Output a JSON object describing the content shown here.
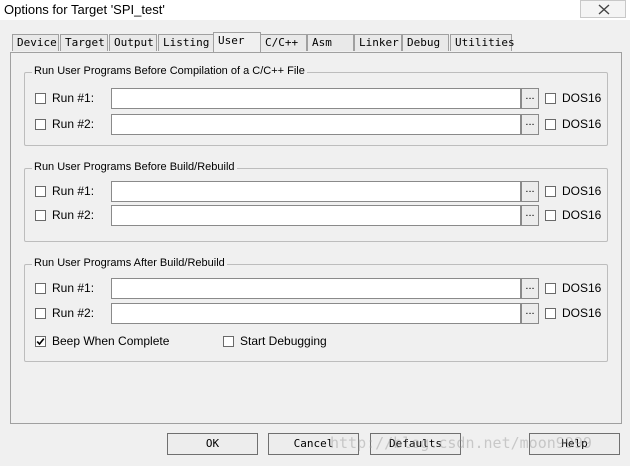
{
  "window": {
    "title": "Options for Target 'SPI_test'"
  },
  "tabs": [
    {
      "label": "Device"
    },
    {
      "label": "Target"
    },
    {
      "label": "Output"
    },
    {
      "label": "Listing"
    },
    {
      "label": "User"
    },
    {
      "label": "C/C++"
    },
    {
      "label": "Asm"
    },
    {
      "label": "Linker"
    },
    {
      "label": "Debug"
    },
    {
      "label": "Utilities"
    }
  ],
  "active_tab": "User",
  "groups": [
    {
      "title": "Run User Programs Before Compilation of a C/C++ File",
      "rows": [
        {
          "label": "Run #1:",
          "checked": false,
          "value": "",
          "browse": "...",
          "dos": "DOS16",
          "dos_checked": false
        },
        {
          "label": "Run #2:",
          "checked": false,
          "value": "",
          "browse": "...",
          "dos": "DOS16",
          "dos_checked": false
        }
      ]
    },
    {
      "title": "Run User Programs Before Build/Rebuild",
      "rows": [
        {
          "label": "Run #1:",
          "checked": false,
          "value": "",
          "browse": "...",
          "dos": "DOS16",
          "dos_checked": false
        },
        {
          "label": "Run #2:",
          "checked": false,
          "value": "",
          "browse": "...",
          "dos": "DOS16",
          "dos_checked": false
        }
      ]
    },
    {
      "title": "Run User Programs After Build/Rebuild",
      "rows": [
        {
          "label": "Run #1:",
          "checked": false,
          "value": "",
          "browse": "...",
          "dos": "DOS16",
          "dos_checked": false
        },
        {
          "label": "Run #2:",
          "checked": false,
          "value": "",
          "browse": "...",
          "dos": "DOS16",
          "dos_checked": false
        }
      ],
      "options": [
        {
          "label": "Beep When Complete",
          "checked": true
        },
        {
          "label": "Start Debugging",
          "checked": false
        }
      ]
    }
  ],
  "buttons": {
    "ok": "OK",
    "cancel": "Cancel",
    "defaults": "Defaults",
    "help": "Help"
  },
  "watermark": "http://blog.csdn.net/moon9999"
}
